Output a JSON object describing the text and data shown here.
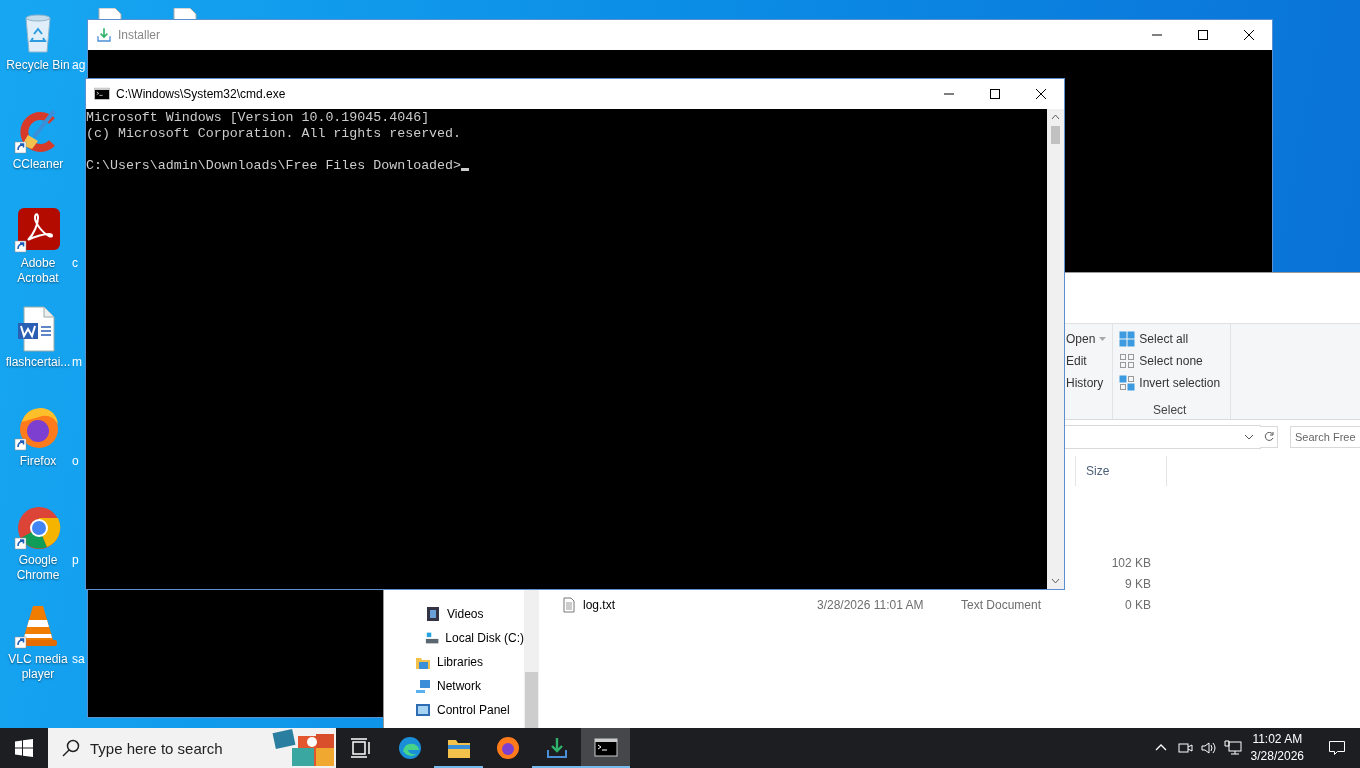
{
  "desktop": {
    "icons": [
      {
        "label": "Recycle Bin",
        "kind": "recycle-bin",
        "shortcut": false,
        "neighbor_label": "ag"
      },
      {
        "label": "CCleaner",
        "kind": "ccleaner",
        "shortcut": true
      },
      {
        "label": "Adobe Acrobat",
        "kind": "acrobat",
        "shortcut": true,
        "neighbor_label": "c"
      },
      {
        "label": "flashcertai...",
        "kind": "word-doc",
        "shortcut": false,
        "neighbor_label": "m"
      },
      {
        "label": "Firefox",
        "kind": "firefox",
        "shortcut": true,
        "neighbor_label": "o"
      },
      {
        "label": "Google Chrome",
        "kind": "chrome",
        "shortcut": true,
        "neighbor_label": "p"
      },
      {
        "label": "VLC media player",
        "kind": "vlc",
        "shortcut": true,
        "neighbor_label": "sa"
      }
    ]
  },
  "installer_window": {
    "title": "Installer"
  },
  "explorer_window": {
    "ribbon": {
      "open_group": [
        {
          "label": "Open",
          "kind": "dropdown"
        },
        {
          "label": "Edit",
          "kind": "plain"
        },
        {
          "label": "History",
          "kind": "plain"
        }
      ],
      "select_group": {
        "label": "Select",
        "items": [
          {
            "label": "Select all",
            "kind": "select-all"
          },
          {
            "label": "Select none",
            "kind": "select-none"
          },
          {
            "label": "Invert selection",
            "kind": "invert"
          }
        ]
      }
    },
    "search": {
      "placeholder": "Search Free"
    },
    "columns": [
      "Size"
    ],
    "rows": [
      {
        "size": "102 KB"
      },
      {
        "size": "9 KB"
      },
      {
        "name": "log.txt",
        "date": "3/28/2026 11:01 AM",
        "type": "Text Document",
        "size": "0 KB"
      }
    ],
    "nav_pane": {
      "this_pc_children": [
        {
          "label": "Videos",
          "kind": "videos"
        },
        {
          "label": "Local Disk (C:)",
          "kind": "disk"
        }
      ],
      "items": [
        {
          "label": "Libraries",
          "kind": "libraries"
        },
        {
          "label": "Network",
          "kind": "network"
        },
        {
          "label": "Control Panel",
          "kind": "control-panel"
        }
      ]
    }
  },
  "cmd_window": {
    "title": "C:\\Windows\\System32\\cmd.exe",
    "header_lines": [
      "Microsoft Windows [Version 10.0.19045.4046]",
      "(c) Microsoft Corporation. All rights reserved."
    ],
    "prompt": "C:\\Users\\admin\\Downloads\\Free Files Downloaded>"
  },
  "taskbar": {
    "search": {
      "placeholder": "Type here to search"
    },
    "apps": [
      {
        "kind": "task-view",
        "running": false,
        "selected": false
      },
      {
        "kind": "edge",
        "running": false,
        "selected": false
      },
      {
        "kind": "explorer",
        "running": true,
        "selected": false
      },
      {
        "kind": "firefox",
        "running": false,
        "selected": false
      },
      {
        "kind": "installer",
        "running": true,
        "selected": false
      },
      {
        "kind": "cmd",
        "running": true,
        "selected": true
      }
    ],
    "clock": {
      "time": "11:02 AM",
      "date": "3/28/2026"
    }
  }
}
